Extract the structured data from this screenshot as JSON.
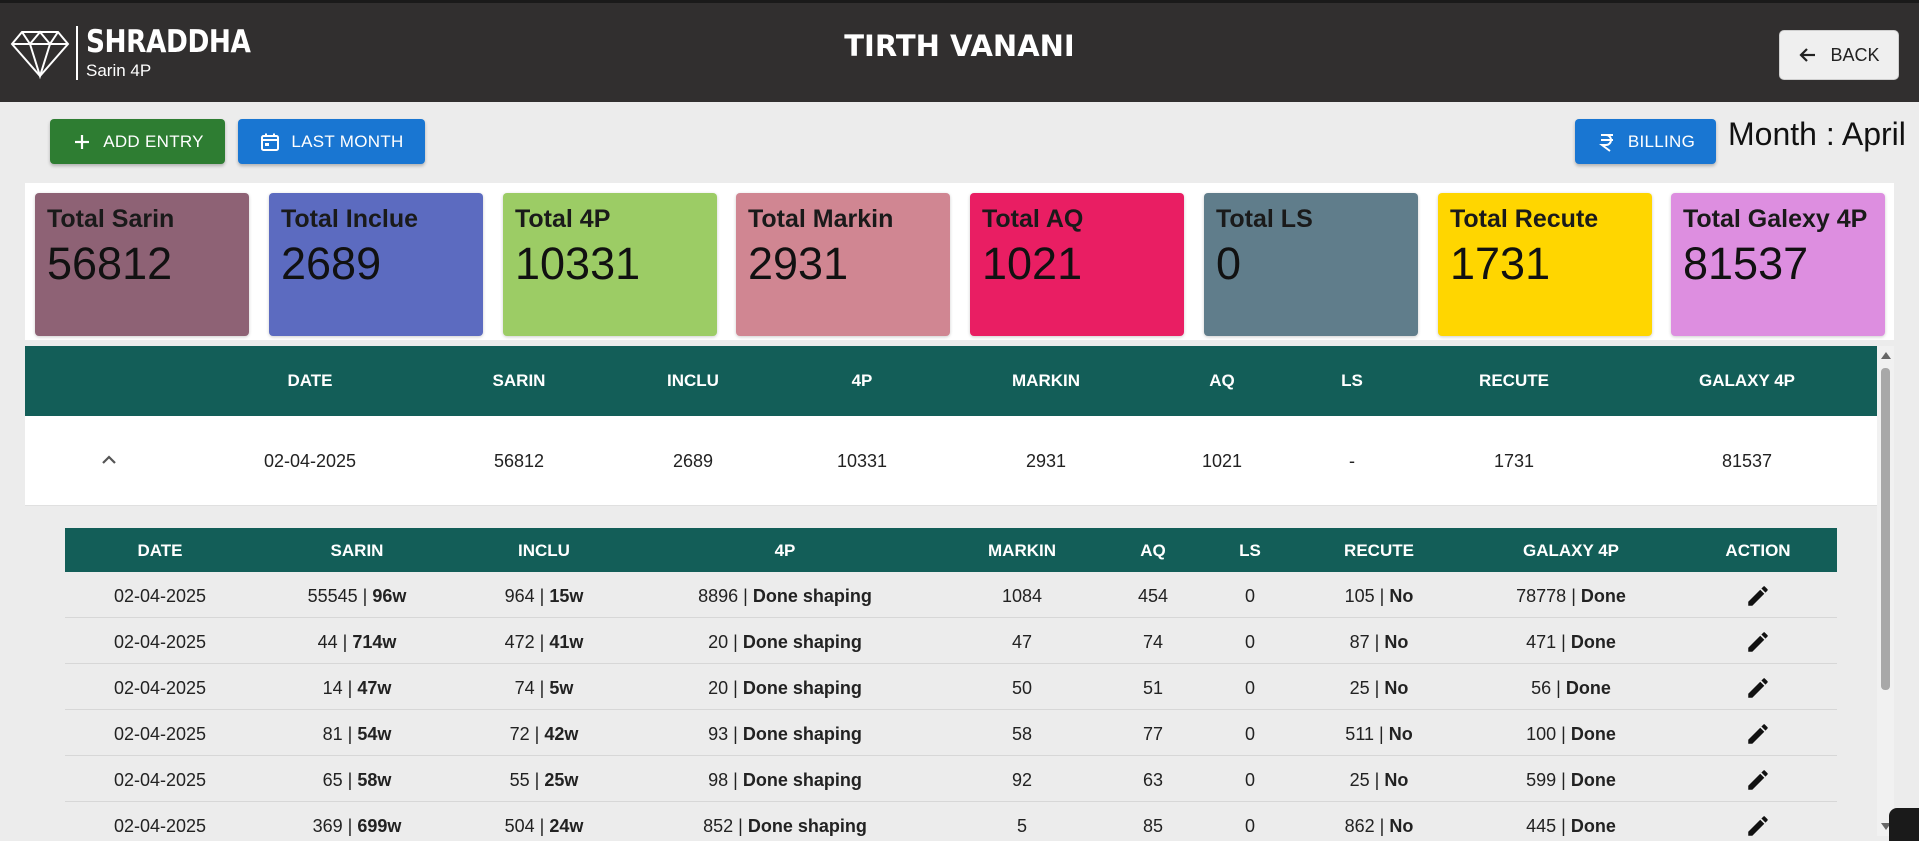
{
  "header": {
    "brand": "SHRADDHA",
    "subtitle": "Sarin 4P",
    "title": "TIRTH VANANI",
    "back_label": "BACK"
  },
  "toolbar": {
    "add_entry_label": "ADD ENTRY",
    "last_month_label": "LAST MONTH",
    "billing_label": "BILLING",
    "month_text": "Month : April"
  },
  "cards": [
    {
      "label": "Total Sarin",
      "value": "56812",
      "color": "#8e6275"
    },
    {
      "label": "Total Inclue",
      "value": "2689",
      "color": "#5c6bc0"
    },
    {
      "label": "Total 4P",
      "value": "10331",
      "color": "#9ccc65"
    },
    {
      "label": "Total Markin",
      "value": "2931",
      "color": "#d08692"
    },
    {
      "label": "Total AQ",
      "value": "1021",
      "color": "#e91e63"
    },
    {
      "label": "Total LS",
      "value": "0",
      "color": "#607d8b"
    },
    {
      "label": "Total Recute",
      "value": "1731",
      "color": "#ffd600"
    },
    {
      "label": "Total Galexy 4P",
      "value": "81537",
      "color": "#dd8ee0"
    }
  ],
  "main_table": {
    "headers": [
      "DATE",
      "SARIN",
      "INCLU",
      "4P",
      "MARKIN",
      "AQ",
      "LS",
      "RECUTE",
      "GALAXY 4P"
    ],
    "row": [
      "02-04-2025",
      "56812",
      "2689",
      "10331",
      "2931",
      "1021",
      "-",
      "1731",
      "81537"
    ]
  },
  "detail_table": {
    "headers": [
      "DATE",
      "SARIN",
      "INCLU",
      "4P",
      "MARKIN",
      "AQ",
      "LS",
      "RECUTE",
      "GALAXY 4P",
      "ACTION"
    ],
    "rows": [
      {
        "date": "02-04-2025",
        "sarin": "55545",
        "sarin_w": "96w",
        "inclu": "964",
        "inclu_w": "15w",
        "p4": "8896",
        "p4_s": "Done shaping",
        "markin": "1084",
        "aq": "454",
        "ls": "0",
        "recute": "105",
        "recute_s": "No",
        "galaxy": "78778",
        "galaxy_s": "Done"
      },
      {
        "date": "02-04-2025",
        "sarin": "44",
        "sarin_w": "714w",
        "inclu": "472",
        "inclu_w": "41w",
        "p4": "20",
        "p4_s": "Done shaping",
        "markin": "47",
        "aq": "74",
        "ls": "0",
        "recute": "87",
        "recute_s": "No",
        "galaxy": "471",
        "galaxy_s": "Done"
      },
      {
        "date": "02-04-2025",
        "sarin": "14",
        "sarin_w": "47w",
        "inclu": "74",
        "inclu_w": "5w",
        "p4": "20",
        "p4_s": "Done shaping",
        "markin": "50",
        "aq": "51",
        "ls": "0",
        "recute": "25",
        "recute_s": "No",
        "galaxy": "56",
        "galaxy_s": "Done"
      },
      {
        "date": "02-04-2025",
        "sarin": "81",
        "sarin_w": "54w",
        "inclu": "72",
        "inclu_w": "42w",
        "p4": "93",
        "p4_s": "Done shaping",
        "markin": "58",
        "aq": "77",
        "ls": "0",
        "recute": "511",
        "recute_s": "No",
        "galaxy": "100",
        "galaxy_s": "Done"
      },
      {
        "date": "02-04-2025",
        "sarin": "65",
        "sarin_w": "58w",
        "inclu": "55",
        "inclu_w": "25w",
        "p4": "98",
        "p4_s": "Done shaping",
        "markin": "92",
        "aq": "63",
        "ls": "0",
        "recute": "25",
        "recute_s": "No",
        "galaxy": "599",
        "galaxy_s": "Done"
      },
      {
        "date": "02-04-2025",
        "sarin": "369",
        "sarin_w": "699w",
        "inclu": "504",
        "inclu_w": "24w",
        "p4": "852",
        "p4_s": "Done shaping",
        "markin": "5",
        "aq": "85",
        "ls": "0",
        "recute": "862",
        "recute_s": "No",
        "galaxy": "445",
        "galaxy_s": "Done"
      }
    ],
    "action_icon": "edit-icon"
  }
}
